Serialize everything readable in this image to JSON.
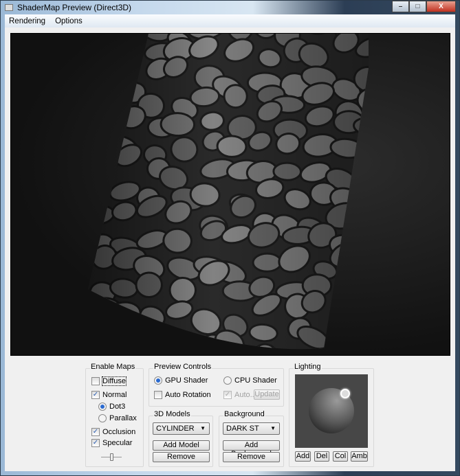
{
  "window": {
    "title": "ShaderMap Preview (Direct3D)",
    "minimize": "–",
    "maximize": "□",
    "close": "X"
  },
  "menu": [
    "Rendering",
    "Options"
  ],
  "enable_maps": {
    "label": "Enable Maps",
    "diffuse": {
      "label": "Diffuse",
      "checked": false
    },
    "normal": {
      "label": "Normal",
      "checked": true
    },
    "dot3": {
      "label": "Dot3",
      "selected": true
    },
    "parallax": {
      "label": "Parallax",
      "selected": false
    },
    "occlusion": {
      "label": "Occlusion",
      "checked": true
    },
    "specular": {
      "label": "Specular",
      "checked": true
    }
  },
  "preview_controls": {
    "label": "Preview Controls",
    "gpu": {
      "label": "GPU Shader",
      "selected": true
    },
    "cpu": {
      "label": "CPU Shader",
      "selected": false
    },
    "auto_rotation": {
      "label": "Auto Rotation",
      "checked": false
    },
    "auto": {
      "label": "Auto..",
      "checked": true,
      "disabled": true
    },
    "update": "Update"
  },
  "models": {
    "label": "3D Models",
    "selected": "CYLINDER",
    "add": "Add Model",
    "remove": "Remove"
  },
  "background": {
    "label": "Background",
    "selected": "DARK ST",
    "add": "Add Background",
    "remove": "Remove"
  },
  "lighting": {
    "label": "Lighting",
    "buttons": [
      "Add",
      "Del",
      "Col",
      "Amb"
    ]
  }
}
